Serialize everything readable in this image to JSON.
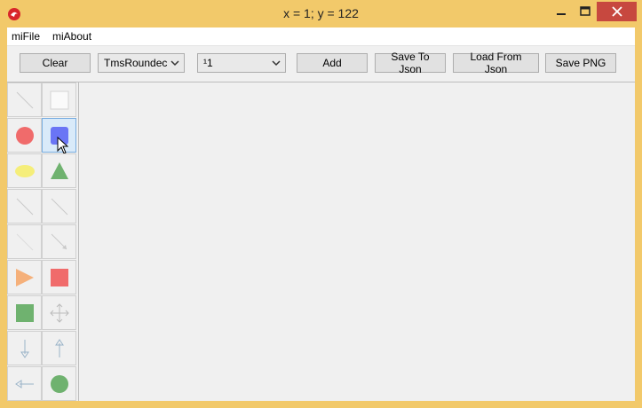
{
  "window": {
    "title": "x = 1; y = 122"
  },
  "menu": {
    "items": [
      "miFile",
      "miAbout"
    ]
  },
  "toolbar": {
    "clear_label": "Clear",
    "shape_combo_value": "TmsRoundec",
    "size_combo_value": "¹1",
    "add_label": "Add",
    "save_json_label": "Save To Json",
    "load_json_label": "Load From Json",
    "save_png_label": "Save PNG"
  },
  "palette": {
    "tools": [
      {
        "name": "line-tool",
        "icon": "line-icon"
      },
      {
        "name": "rectangle-tool",
        "icon": "blank-rect-icon"
      },
      {
        "name": "circle-tool",
        "icon": "red-circle-icon",
        "color": "#f06b6b"
      },
      {
        "name": "rounded-rect-tool",
        "icon": "blue-rounded-rect-icon",
        "color": "#6a75f5"
      },
      {
        "name": "ellipse-tool",
        "icon": "yellow-ellipse-icon",
        "color": "#f5ee7a"
      },
      {
        "name": "triangle-tool",
        "icon": "green-triangle-icon",
        "color": "#6fb26f"
      },
      {
        "name": "line-tool-2",
        "icon": "line-icon"
      },
      {
        "name": "line-tool-3",
        "icon": "line-icon"
      },
      {
        "name": "line-tool-4",
        "icon": "line-icon"
      },
      {
        "name": "arrow-line-tool",
        "icon": "arrow-line-icon"
      },
      {
        "name": "play-triangle-tool",
        "icon": "orange-triangle-icon",
        "color": "#f5b07a"
      },
      {
        "name": "red-square-tool",
        "icon": "red-square-icon",
        "color": "#f06b6b"
      },
      {
        "name": "green-square-tool",
        "icon": "green-square-icon",
        "color": "#6fb26f"
      },
      {
        "name": "move-tool",
        "icon": "move-icon"
      },
      {
        "name": "down-arrow-tool",
        "icon": "arrow-down-icon"
      },
      {
        "name": "up-arrow-tool",
        "icon": "arrow-up-icon"
      },
      {
        "name": "left-arrow-tool",
        "icon": "arrow-left-icon"
      },
      {
        "name": "green-circle-tool",
        "icon": "green-circle-icon",
        "color": "#6fb26f"
      }
    ],
    "selected_index": 3
  }
}
